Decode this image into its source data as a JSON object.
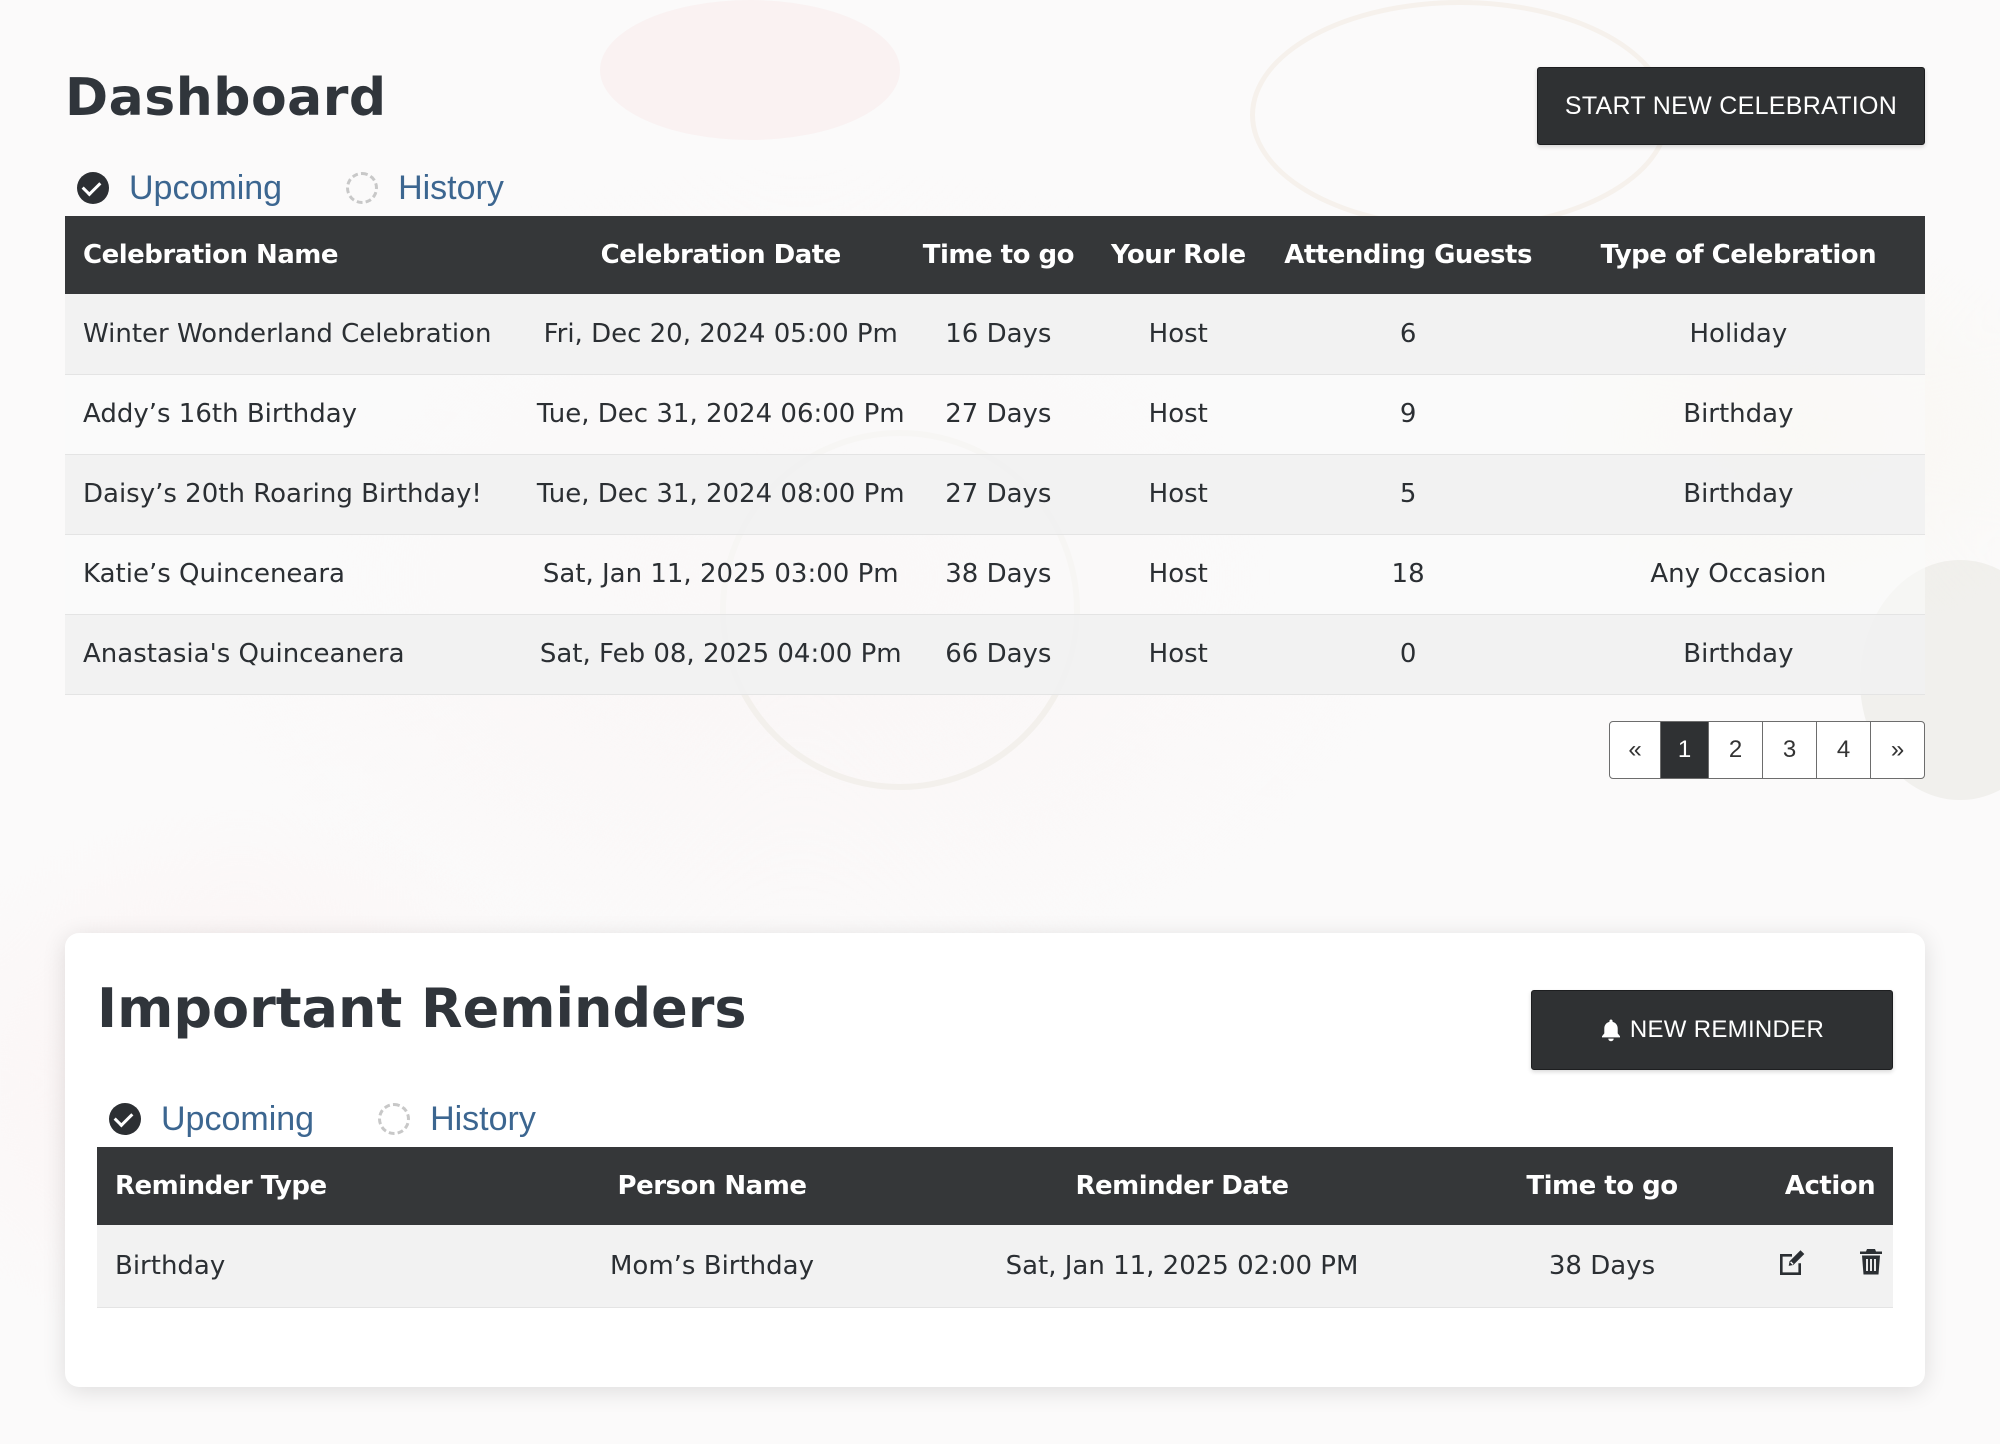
{
  "header": {
    "title": "Dashboard",
    "start_button": "START NEW CELEBRATION"
  },
  "celebration_tabs": [
    {
      "label": "Upcoming",
      "selected": true
    },
    {
      "label": "History",
      "selected": false
    }
  ],
  "celebrations": {
    "columns": [
      "Celebration Name",
      "Celebration Date",
      "Time to go",
      "Your Role",
      "Attending Guests",
      "Type of Celebration"
    ],
    "rows": [
      {
        "name": "Winter Wonderland Celebration",
        "date": "Fri, Dec 20, 2024 05:00 Pm",
        "time_to_go": "16 Days",
        "role": "Host",
        "guests": "6",
        "type": "Holiday"
      },
      {
        "name": "Addy’s 16th Birthday",
        "date": "Tue, Dec 31, 2024 06:00 Pm",
        "time_to_go": "27 Days",
        "role": "Host",
        "guests": "9",
        "type": "Birthday"
      },
      {
        "name": "Daisy’s 20th Roaring Birthday!",
        "date": "Tue, Dec 31, 2024 08:00 Pm",
        "time_to_go": "27 Days",
        "role": "Host",
        "guests": "5",
        "type": "Birthday"
      },
      {
        "name": "Katie’s Quinceneara",
        "date": "Sat, Jan 11, 2025 03:00 Pm",
        "time_to_go": "38 Days",
        "role": "Host",
        "guests": "18",
        "type": "Any Occasion"
      },
      {
        "name": "Anastasia's Quinceanera",
        "date": "Sat, Feb 08, 2025 04:00 Pm",
        "time_to_go": "66 Days",
        "role": "Host",
        "guests": "0",
        "type": "Birthday"
      }
    ]
  },
  "pagination": {
    "prev": "«",
    "pages": [
      "1",
      "2",
      "3",
      "4"
    ],
    "current": "1",
    "next": "»"
  },
  "reminders": {
    "title": "Important Reminders",
    "new_button": "NEW REMINDER",
    "tabs": [
      {
        "label": "Upcoming",
        "selected": true
      },
      {
        "label": "History",
        "selected": false
      }
    ],
    "columns": [
      "Reminder Type",
      "Person Name",
      "Reminder Date",
      "Time to go",
      "Action"
    ],
    "rows": [
      {
        "type": "Birthday",
        "person": "Mom’s Birthday",
        "date": "Sat, Jan 11, 2025 02:00 PM",
        "time_to_go": "38 Days",
        "actions": [
          "edit-icon",
          "trash-icon"
        ]
      }
    ]
  },
  "colors": {
    "dark": "#2f3133",
    "header_row": "#353739",
    "tab_text": "#3c6690"
  }
}
